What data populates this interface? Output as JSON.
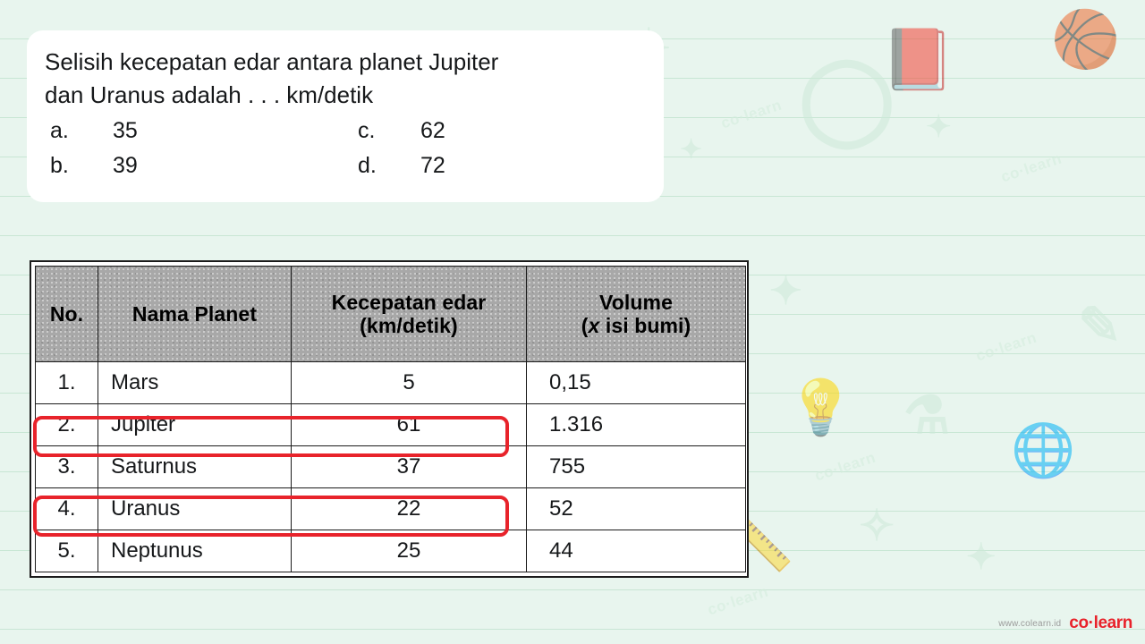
{
  "question": {
    "line1": "Selisih kecepatan edar antara planet Jupiter",
    "line2": "dan Uranus adalah . . . km/detik",
    "options": [
      {
        "label": "a.",
        "value": "35"
      },
      {
        "label": "b.",
        "value": "39"
      },
      {
        "label": "c.",
        "value": "62"
      },
      {
        "label": "d.",
        "value": "72"
      }
    ]
  },
  "table": {
    "headers": {
      "no": "No.",
      "name": "Nama Planet",
      "speed_line1": "Kecepatan edar",
      "speed_line2": "(km/detik)",
      "volume_line1": "Volume",
      "volume_line2_pre": "(",
      "volume_line2_x": "x",
      "volume_line2_post": " isi bumi)"
    },
    "rows": [
      {
        "no": "1.",
        "name": "Mars",
        "speed": "5",
        "volume": "0,15"
      },
      {
        "no": "2.",
        "name": "Jupiter",
        "speed": "61",
        "volume": "1.316"
      },
      {
        "no": "3.",
        "name": "Saturnus",
        "speed": "37",
        "volume": "755"
      },
      {
        "no": "4.",
        "name": "Uranus",
        "speed": "22",
        "volume": "52"
      },
      {
        "no": "5.",
        "name": "Neptunus",
        "speed": "25",
        "volume": "44"
      }
    ],
    "highlighted_rows": [
      2,
      4
    ],
    "highlight_color": "#e8232b"
  },
  "footer": {
    "url": "www.colearn.id",
    "logo": "co·learn"
  },
  "watermarks": [
    "co·learn",
    "co·learn",
    "co·learn",
    "co·learn",
    "co·learn"
  ],
  "theme": {
    "background": "#e8f5ee",
    "rule_line": "#c8e6d4",
    "card_background": "#ffffff",
    "header_fill": "#a8a8a8",
    "text": "#16181a",
    "accent": "#e8232b"
  }
}
